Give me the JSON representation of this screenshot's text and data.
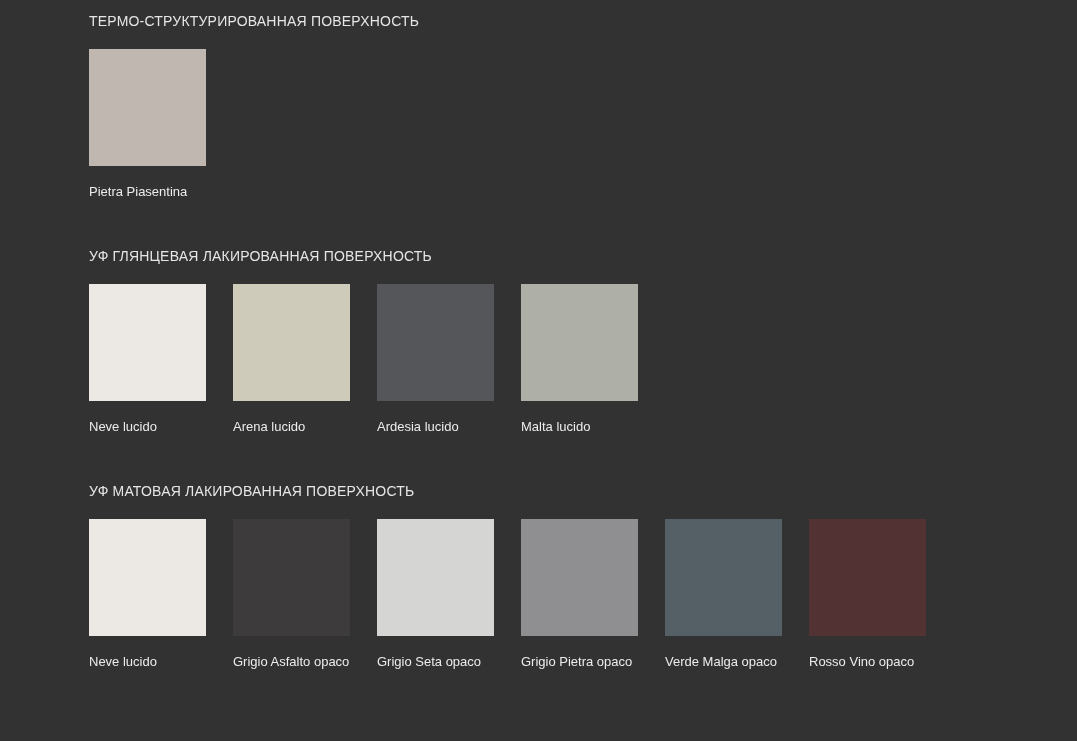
{
  "sections": [
    {
      "title": "ТЕРМО-СТРУКТУРИРОВАННАЯ ПОВЕРХНОСТЬ",
      "swatches": [
        {
          "name": "Pietra Piasentina",
          "color": "#c0b8b0"
        }
      ]
    },
    {
      "title": "УФ ГЛЯНЦЕВАЯ ЛАКИРОВАННАЯ ПОВЕРХНОСТЬ",
      "swatches": [
        {
          "name": "Neve lucido",
          "color": "#ece9e4"
        },
        {
          "name": "Arena lucido",
          "color": "#cfcbba"
        },
        {
          "name": "Ardesia lucido",
          "color": "#55565a"
        },
        {
          "name": "Malta lucido",
          "color": "#aeafa7"
        }
      ]
    },
    {
      "title": "УФ МАТОВАЯ ЛАКИРОВАННАЯ ПОВЕРХНОСТЬ",
      "swatches": [
        {
          "name": "Neve lucido",
          "color": "#ece9e4"
        },
        {
          "name": "Grigio Asfalto opaco",
          "color": "#3e3b3c"
        },
        {
          "name": "Grigio Seta opaco",
          "color": "#d5d5d3"
        },
        {
          "name": "Grigio Pietra opaco",
          "color": "#8f8f91"
        },
        {
          "name": "Verde Malga opaco",
          "color": "#556066"
        },
        {
          "name": "Rosso Vino opaco",
          "color": "#523232"
        }
      ]
    }
  ]
}
